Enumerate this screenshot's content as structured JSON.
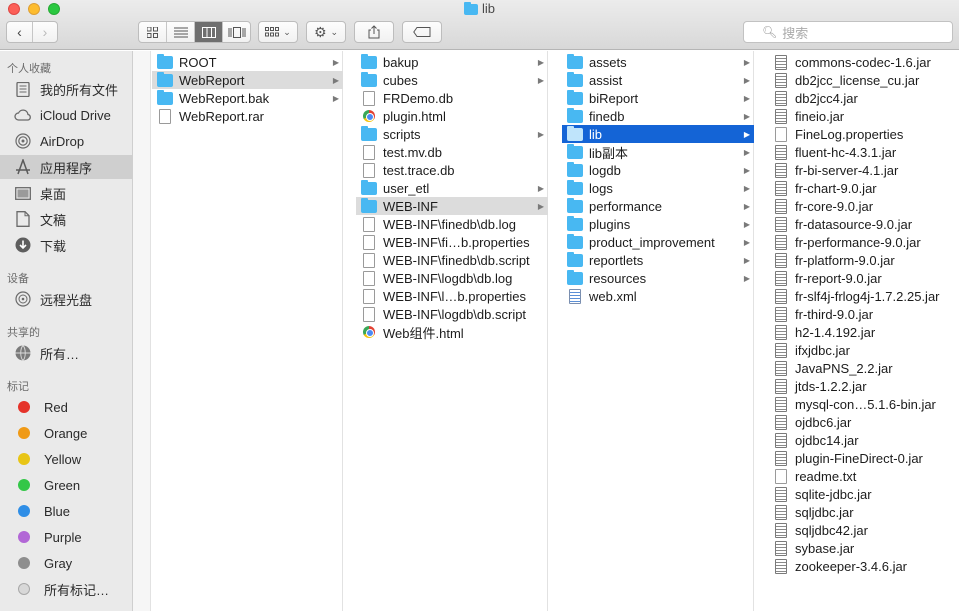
{
  "window": {
    "title": "lib"
  },
  "toolbar": {
    "nav_back": "‹",
    "nav_forward": "›",
    "share_icon": "share-icon",
    "search_placeholder": "搜索"
  },
  "sidebar": {
    "favorites_header": "个人收藏",
    "favorites": [
      {
        "label": "我的所有文件",
        "icon": "all-files-icon"
      },
      {
        "label": "iCloud Drive",
        "icon": "cloud-icon"
      },
      {
        "label": "AirDrop",
        "icon": "airdrop-icon"
      },
      {
        "label": "应用程序",
        "icon": "applications-icon",
        "selected": true
      },
      {
        "label": "桌面",
        "icon": "desktop-icon"
      },
      {
        "label": "文稿",
        "icon": "documents-icon"
      },
      {
        "label": "下载",
        "icon": "downloads-icon"
      }
    ],
    "devices_header": "设备",
    "devices": [
      {
        "label": "远程光盘",
        "icon": "disc-icon"
      }
    ],
    "shared_header": "共享的",
    "shared": [
      {
        "label": "所有…",
        "icon": "network-icon"
      }
    ],
    "tags_header": "标记",
    "tags": [
      {
        "label": "Red",
        "color": "#e5332a"
      },
      {
        "label": "Orange",
        "color": "#f09a16"
      },
      {
        "label": "Yellow",
        "color": "#e8c516"
      },
      {
        "label": "Green",
        "color": "#34c748"
      },
      {
        "label": "Blue",
        "color": "#2f8ee6"
      },
      {
        "label": "Purple",
        "color": "#b267d6"
      },
      {
        "label": "Gray",
        "color": "#8e8e8e"
      },
      {
        "label": "所有标记…",
        "color": "#d8d8d8"
      }
    ]
  },
  "columns": [
    {
      "items": [
        {
          "name": "ROOT",
          "type": "folder",
          "arrow": true
        },
        {
          "name": "WebReport",
          "type": "folder",
          "arrow": true,
          "selected": "gray"
        },
        {
          "name": "WebReport.bak",
          "type": "folder",
          "arrow": true
        },
        {
          "name": "WebReport.rar",
          "type": "file"
        }
      ]
    },
    {
      "items": [
        {
          "name": "bakup",
          "type": "folder",
          "arrow": true
        },
        {
          "name": "cubes",
          "type": "folder",
          "arrow": true
        },
        {
          "name": "FRDemo.db",
          "type": "file"
        },
        {
          "name": "plugin.html",
          "type": "html"
        },
        {
          "name": "scripts",
          "type": "folder",
          "arrow": true
        },
        {
          "name": "test.mv.db",
          "type": "file"
        },
        {
          "name": "test.trace.db",
          "type": "file"
        },
        {
          "name": "user_etl",
          "type": "folder",
          "arrow": true
        },
        {
          "name": "WEB-INF",
          "type": "folder",
          "arrow": true,
          "selected": "gray"
        },
        {
          "name": "WEB-INF\\finedb\\db.log",
          "type": "file"
        },
        {
          "name": "WEB-INF\\fi…b.properties",
          "type": "file"
        },
        {
          "name": "WEB-INF\\finedb\\db.script",
          "type": "file"
        },
        {
          "name": "WEB-INF\\logdb\\db.log",
          "type": "file"
        },
        {
          "name": "WEB-INF\\l…b.properties",
          "type": "file"
        },
        {
          "name": "WEB-INF\\logdb\\db.script",
          "type": "file"
        },
        {
          "name": "Web组件.html",
          "type": "html"
        }
      ]
    },
    {
      "items": [
        {
          "name": "assets",
          "type": "folder",
          "arrow": true
        },
        {
          "name": "assist",
          "type": "folder",
          "arrow": true
        },
        {
          "name": "biReport",
          "type": "folder",
          "arrow": true
        },
        {
          "name": "finedb",
          "type": "folder",
          "arrow": true
        },
        {
          "name": "lib",
          "type": "folder",
          "arrow": true,
          "selected": "blue"
        },
        {
          "name": "lib副本",
          "type": "folder",
          "arrow": true
        },
        {
          "name": "logdb",
          "type": "folder",
          "arrow": true
        },
        {
          "name": "logs",
          "type": "folder",
          "arrow": true
        },
        {
          "name": "performance",
          "type": "folder",
          "arrow": true
        },
        {
          "name": "plugins",
          "type": "folder",
          "arrow": true
        },
        {
          "name": "product_improvement",
          "type": "folder",
          "arrow": true
        },
        {
          "name": "reportlets",
          "type": "folder",
          "arrow": true
        },
        {
          "name": "resources",
          "type": "folder",
          "arrow": true
        },
        {
          "name": "web.xml",
          "type": "xml"
        }
      ]
    },
    {
      "items": [
        {
          "name": "commons-codec-1.6.jar",
          "type": "jar"
        },
        {
          "name": "db2jcc_license_cu.jar",
          "type": "jar"
        },
        {
          "name": "db2jcc4.jar",
          "type": "jar"
        },
        {
          "name": "fineio.jar",
          "type": "jar"
        },
        {
          "name": "FineLog.properties",
          "type": "file"
        },
        {
          "name": "fluent-hc-4.3.1.jar",
          "type": "jar"
        },
        {
          "name": "fr-bi-server-4.1.jar",
          "type": "jar"
        },
        {
          "name": "fr-chart-9.0.jar",
          "type": "jar"
        },
        {
          "name": "fr-core-9.0.jar",
          "type": "jar"
        },
        {
          "name": "fr-datasource-9.0.jar",
          "type": "jar"
        },
        {
          "name": "fr-performance-9.0.jar",
          "type": "jar"
        },
        {
          "name": "fr-platform-9.0.jar",
          "type": "jar"
        },
        {
          "name": "fr-report-9.0.jar",
          "type": "jar"
        },
        {
          "name": "fr-slf4j-frlog4j-1.7.2.25.jar",
          "type": "jar"
        },
        {
          "name": "fr-third-9.0.jar",
          "type": "jar"
        },
        {
          "name": "h2-1.4.192.jar",
          "type": "jar"
        },
        {
          "name": "ifxjdbc.jar",
          "type": "jar"
        },
        {
          "name": "JavaPNS_2.2.jar",
          "type": "jar"
        },
        {
          "name": "jtds-1.2.2.jar",
          "type": "jar"
        },
        {
          "name": "mysql-con…5.1.6-bin.jar",
          "type": "jar"
        },
        {
          "name": "ojdbc6.jar",
          "type": "jar"
        },
        {
          "name": "ojdbc14.jar",
          "type": "jar"
        },
        {
          "name": "plugin-FineDirect-0.jar",
          "type": "jar"
        },
        {
          "name": "readme.txt",
          "type": "file"
        },
        {
          "name": "sqlite-jdbc.jar",
          "type": "jar"
        },
        {
          "name": "sqljdbc.jar",
          "type": "jar"
        },
        {
          "name": "sqljdbc42.jar",
          "type": "jar"
        },
        {
          "name": "sybase.jar",
          "type": "jar"
        },
        {
          "name": "zookeeper-3.4.6.jar",
          "type": "jar"
        }
      ]
    }
  ]
}
